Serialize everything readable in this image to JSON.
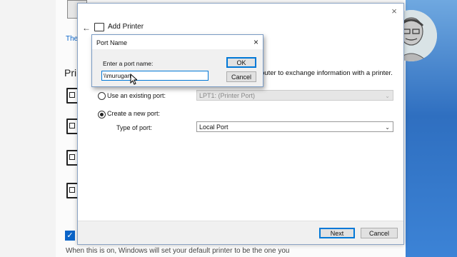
{
  "background": {
    "link_text": "The",
    "heading": "Pri",
    "checkbox_mark": "✓",
    "bottom_text": "When this is on, Windows will set your default printer to be the one you"
  },
  "wizard": {
    "title": "Add Printer",
    "close_glyph": "×",
    "back_glyph": "←",
    "description": "puter to exchange information with a printer.",
    "existing_port_label": "Use an existing port:",
    "existing_port_value": "LPT1: (Printer Port)",
    "new_port_label": "Create a new port:",
    "type_of_port_label": "Type of port:",
    "type_of_port_value": "Local Port",
    "chevron": "⌄",
    "next_label": "Next",
    "cancel_label": "Cancel"
  },
  "port_dialog": {
    "title": "Port Name",
    "close_glyph": "×",
    "prompt": "Enter a port name:",
    "input_value": "\\\\murugan",
    "ok_label": "OK",
    "cancel_label": "Cancel"
  },
  "colors": {
    "accent": "#0078d7",
    "desktop_blue": "#3c83d6"
  }
}
